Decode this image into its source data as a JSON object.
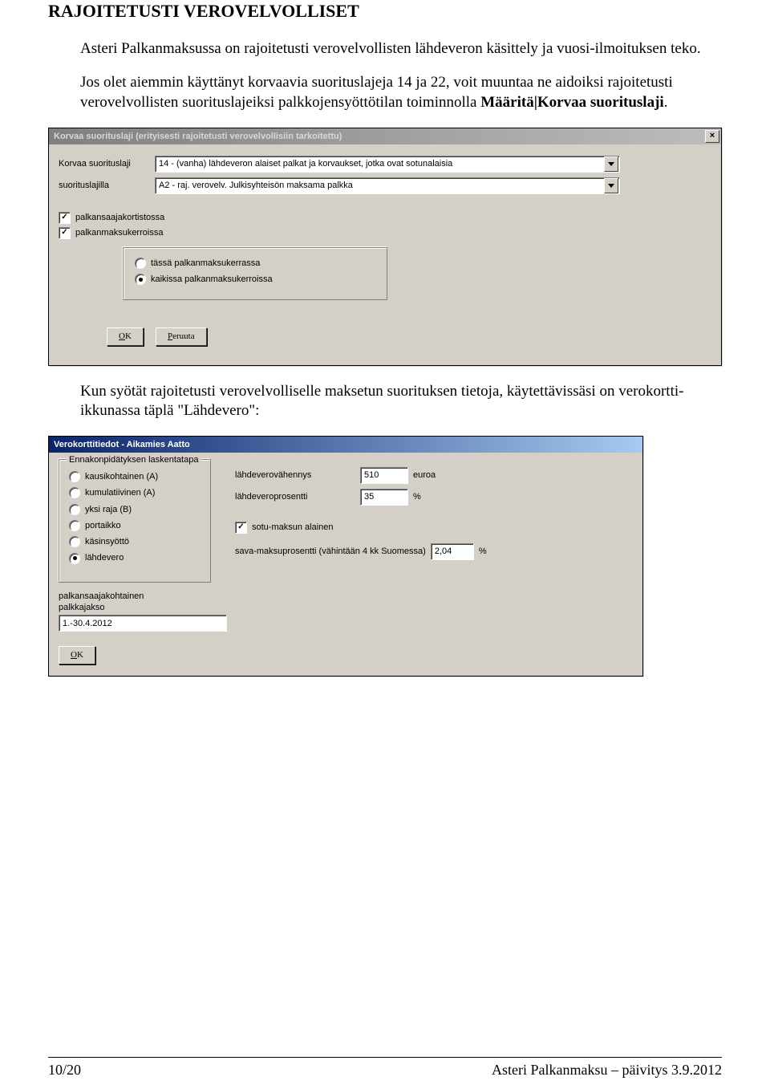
{
  "heading": "RAJOITETUSTI VEROVELVOLLISET",
  "intro1": "Asteri Palkanmaksussa on rajoitetusti verovelvollisten lähdeveron käsittely ja vuosi-ilmoituksen teko.",
  "intro2_a": "Jos olet aiemmin käyttänyt korvaavia suorituslajeja 14 ja 22, voit muuntaa ne aidoiksi rajoitetusti verovelvollisten suorituslajeiksi palkkojensyöttötilan toiminnolla ",
  "intro2_bold": "Määritä|Korvaa suorituslaji",
  "intro2_b": ".",
  "win1": {
    "title": "Korvaa suorituslaji (erityisesti rajoitetusti verovelvollisiin tarkoitettu)",
    "label1": "Korvaa suorituslaji",
    "combo1": "14   - (vanha) lähdeveron alaiset palkat ja korvaukset, jotka ovat sotunalaisia",
    "label2": "suorituslajilla",
    "combo2": "A2   - raj. verovelv. Julkisyhteisön maksama palkka",
    "check1": "palkansaajakortistossa",
    "check2": "palkanmaksukerroissa",
    "radio1": "tässä palkanmaksukerrassa",
    "radio2": "kaikissa palkanmaksukerroissa",
    "ok": "OK",
    "cancel": "Peruuta"
  },
  "middle": "Kun syötät rajoitetusti verovelvolliselle maksetun suorituksen tietoja, käytettävissäsi on verokortti-ikkunassa täplä \"Lähdevero\":",
  "win2": {
    "title": "Verokorttitiedot - Aikamies Aatto",
    "legend": "Ennakonpidätyksen laskentatapa",
    "radios": [
      "kausikohtainen (A)",
      "kumulatiivinen (A)",
      "yksi raja (B)",
      "portaikko",
      "käsinsyöttö",
      "lähdevero"
    ],
    "selected": 5,
    "lvv_label": "lähdeverovähennys",
    "lvv_value": "510",
    "lvv_unit": "euroa",
    "lvp_label": "lähdeveroprosentti",
    "lvp_value": "35",
    "lvp_unit": "%",
    "sotu": "sotu-maksun alainen",
    "sava_label": "sava-maksuprosentti (vähintään 4 kk Suomessa)",
    "sava_value": "2,04",
    "sava_unit": "%",
    "pjakso_label1": "palkansaajakohtainen",
    "pjakso_label2": "palkkajakso",
    "pjakso_value": "1.-30.4.2012",
    "ok": "OK"
  },
  "footer_left": "10/20",
  "footer_right": "Asteri Palkanmaksu – päivitys 3.9.2012"
}
